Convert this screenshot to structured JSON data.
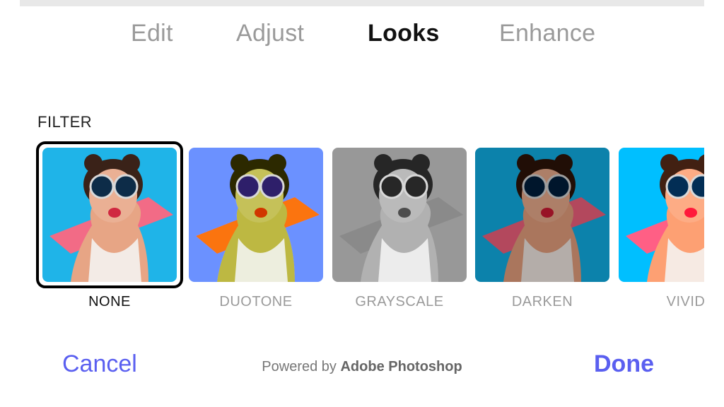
{
  "tabs": [
    {
      "label": "Edit",
      "active": false
    },
    {
      "label": "Adjust",
      "active": false
    },
    {
      "label": "Looks",
      "active": true
    },
    {
      "label": "Enhance",
      "active": false
    }
  ],
  "section": {
    "title": "FILTER"
  },
  "filters": [
    {
      "label": "NONE",
      "selected": true
    },
    {
      "label": "DUOTONE",
      "selected": false
    },
    {
      "label": "GRAYSCALE",
      "selected": false
    },
    {
      "label": "DARKEN",
      "selected": false
    },
    {
      "label": "VIVID",
      "selected": false
    }
  ],
  "footer": {
    "cancel_label": "Cancel",
    "done_label": "Done",
    "powered_prefix": "Powered by",
    "powered_brand": "Adobe Photoshop"
  },
  "colors": {
    "accent": "#5a5ff0",
    "active_tab": "#111111",
    "inactive_tab": "#9a9a9a",
    "thumb_background": "#1fb4e8"
  }
}
